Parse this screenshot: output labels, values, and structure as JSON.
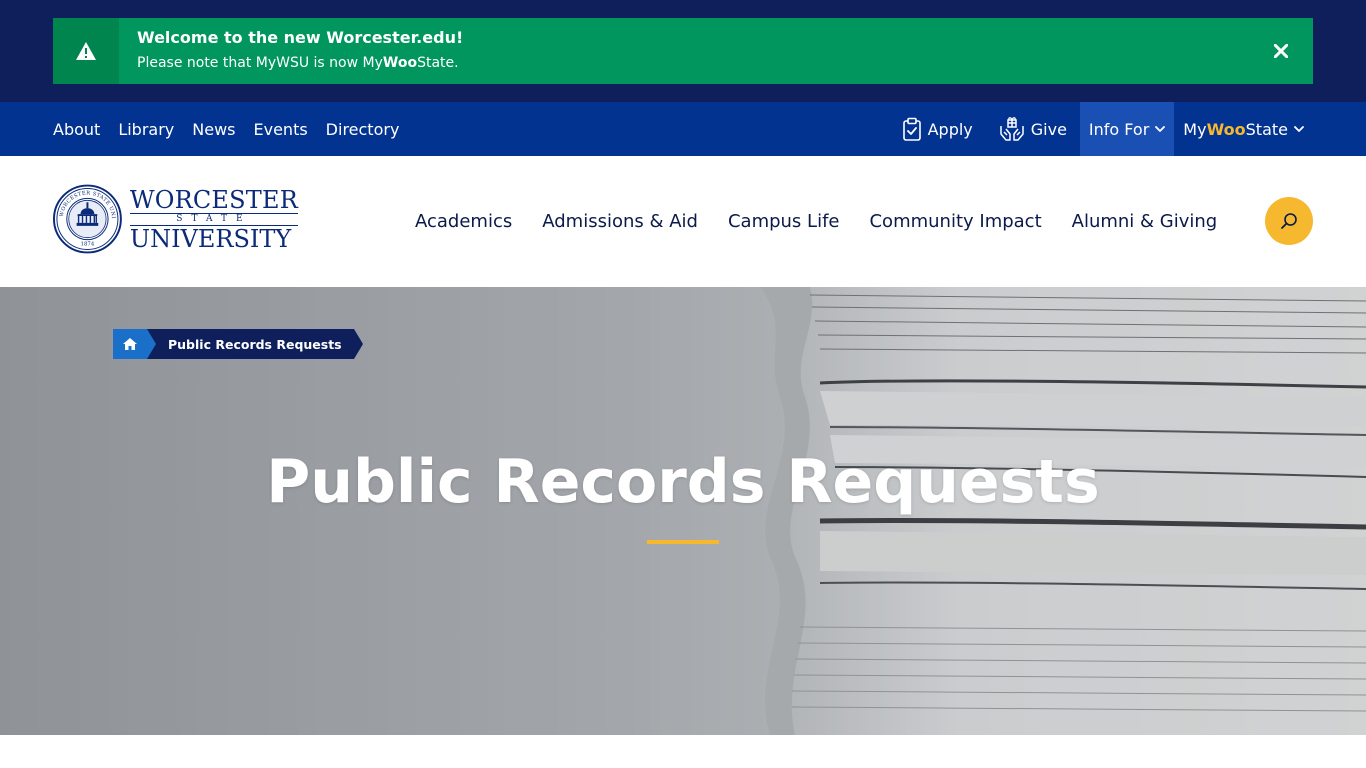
{
  "alert": {
    "icon": "warning-icon",
    "title": "Welcome to the new Worcester.edu!",
    "message_prefix": "Please note that MyWSU is now My",
    "message_bold": "Woo",
    "message_suffix": "State.",
    "close_icon": "close-icon"
  },
  "utility_nav": {
    "links": [
      {
        "label": "About"
      },
      {
        "label": "Library"
      },
      {
        "label": "News"
      },
      {
        "label": "Events"
      },
      {
        "label": "Directory"
      }
    ],
    "apply": {
      "label": "Apply",
      "icon": "clipboard-check-icon"
    },
    "give": {
      "label": "Give",
      "icon": "giving-hands-icon"
    },
    "info_for": {
      "label": "Info For",
      "icon": "chevron-down-icon"
    },
    "mywoostate": {
      "prefix": "My",
      "bold": "Woo",
      "suffix": "State",
      "icon": "chevron-down-icon"
    }
  },
  "logo": {
    "line1": "WORCESTER",
    "line2": "STATE",
    "line3": "UNIVERSITY",
    "seal_text": "WORCESTER STATE UNIVERSITY",
    "seal_year": "1874"
  },
  "main_nav": {
    "items": [
      {
        "label": "Academics"
      },
      {
        "label": "Admissions & Aid"
      },
      {
        "label": "Campus Life"
      },
      {
        "label": "Community Impact"
      },
      {
        "label": "Alumni & Giving"
      }
    ],
    "search_icon": "search-icon"
  },
  "breadcrumb": {
    "home_icon": "home-icon",
    "current": "Public Records Requests"
  },
  "hero": {
    "title": "Public Records Requests"
  },
  "colors": {
    "navy": "#0f1f5c",
    "util_blue": "#033391",
    "alert_green": "#00965e",
    "gold": "#f5b82e",
    "breadcrumb_blue": "#1a6fc9"
  }
}
